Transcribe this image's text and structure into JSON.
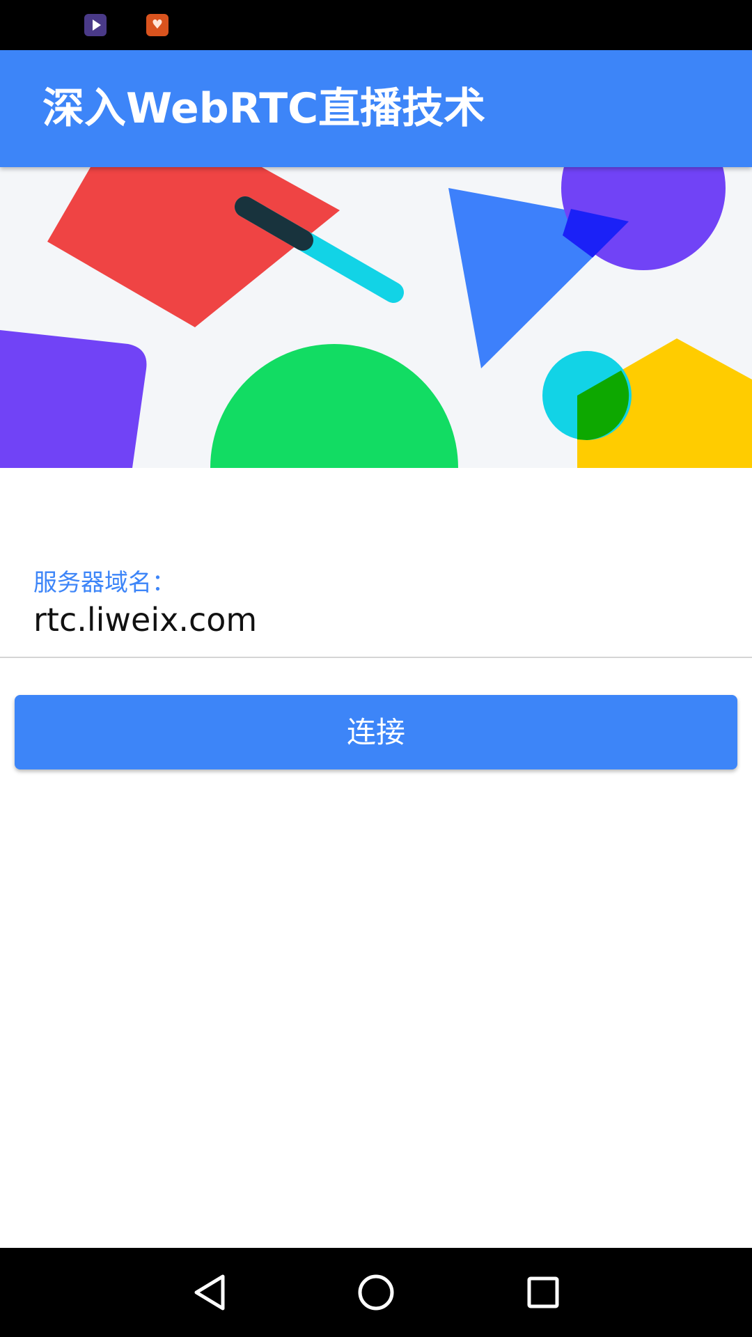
{
  "status_bar": {
    "icons": [
      "video-app-icon",
      "health-app-icon"
    ]
  },
  "app_bar": {
    "title": "深入WebRTC直播技术"
  },
  "server_field": {
    "label": "服务器域名：",
    "value": "rtc.liweix.com"
  },
  "connect_button": {
    "label": "连接"
  },
  "nav_bar": {
    "buttons": [
      "back-icon",
      "home-icon",
      "recents-icon"
    ]
  },
  "colors": {
    "primary": "#3d85f8",
    "accent_label": "#3d85f8",
    "status_bar": "#000000",
    "nav_bar": "#000000"
  }
}
